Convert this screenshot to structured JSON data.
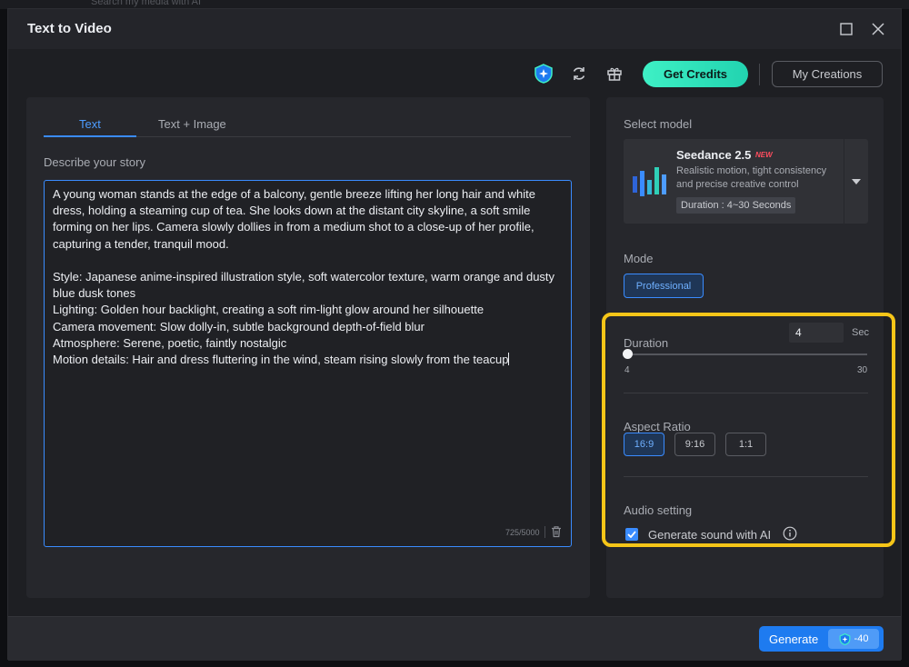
{
  "background": {
    "search_ghost": "Search my media with AI"
  },
  "window": {
    "title": "Text to Video"
  },
  "toolbar": {
    "get_credits_label": "Get Credits",
    "my_creations_label": "My Creations",
    "accent_color": "#2ee0be"
  },
  "tabs": [
    {
      "label": "Text",
      "active": true
    },
    {
      "label": "Text + Image",
      "active": false
    }
  ],
  "story": {
    "label": "Describe your story",
    "text": "A young woman stands at the edge of a balcony, gentle breeze lifting her long hair and white dress, holding a steaming cup of tea. She looks down at the distant city skyline, a soft smile forming on her lips. Camera slowly dollies in from a medium shot to a close-up of her profile, capturing a tender, tranquil mood.\n\nStyle: Japanese anime-inspired illustration style, soft watercolor texture, warm orange and dusty blue dusk tones\nLighting: Golden hour backlight, creating a soft rim-light glow around her silhouette\nCamera movement: Slow dolly-in, subtle background depth-of-field blur\nAtmosphere: Serene, poetic, faintly nostalgic\nMotion details: Hair and dress fluttering in the wind, steam rising slowly from the teacup",
    "counter": "725/5000"
  },
  "model": {
    "label": "Select model",
    "name": "Seedance 2.5",
    "badge": "NEW",
    "description": "Realistic motion, tight consistency and precise creative control",
    "duration_chip": "Duration : 4~30 Seconds"
  },
  "mode": {
    "label": "Mode",
    "selected": "Professional"
  },
  "duration": {
    "label": "Duration",
    "value": "4",
    "unit": "Sec",
    "min": "4",
    "max": "30",
    "slider_fraction": 0
  },
  "aspect_ratio": {
    "label": "Aspect Ratio",
    "options": [
      "16:9",
      "9:16",
      "1:1"
    ],
    "selected": "16:9"
  },
  "audio": {
    "label": "Audio setting",
    "checkbox_label": "Generate sound with AI",
    "checked": true
  },
  "footer": {
    "generate_label": "Generate",
    "cost": "-40"
  },
  "highlight_color": "#f5c518"
}
